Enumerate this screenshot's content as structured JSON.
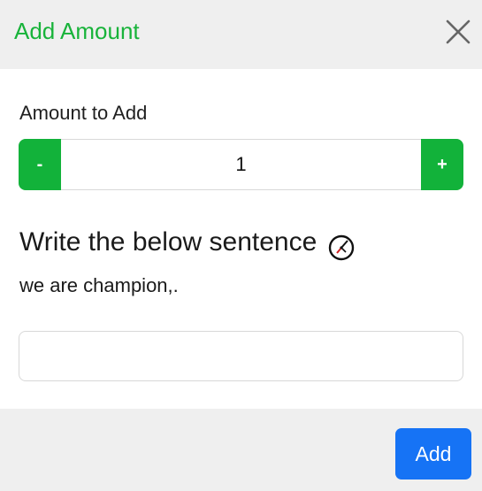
{
  "header": {
    "title": "Add Amount",
    "close_icon": "close-icon",
    "title_color": "#18b33a"
  },
  "amount": {
    "label": "Amount to Add",
    "minus_label": "-",
    "plus_label": "+",
    "value": "1",
    "button_color": "#12b23a"
  },
  "challenge": {
    "heading": "Write the below sentence",
    "icon": "gauge-icon",
    "sentence": "we are champion,.",
    "input_value": "",
    "input_placeholder": ""
  },
  "footer": {
    "add_label": "Add",
    "add_color": "#1673f5"
  }
}
